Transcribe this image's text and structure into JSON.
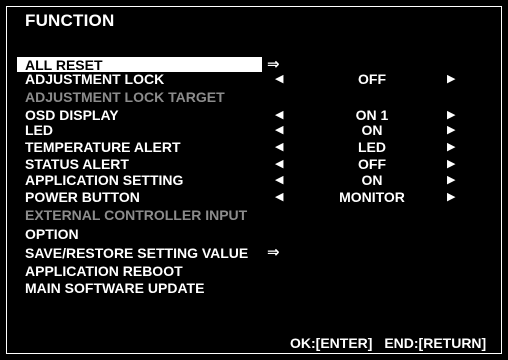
{
  "title": "FUNCTION",
  "icons": {
    "left": "◀",
    "right": "▶",
    "enter": "⇒"
  },
  "rows": [
    {
      "label": "ALL RESET",
      "value": ""
    },
    {
      "label": "ADJUSTMENT LOCK",
      "value": "OFF"
    },
    {
      "label": "ADJUSTMENT LOCK TARGET",
      "value": ""
    },
    {
      "label": "OSD DISPLAY",
      "value": "ON 1"
    },
    {
      "label": "LED",
      "value": "ON"
    },
    {
      "label": "TEMPERATURE ALERT",
      "value": "LED"
    },
    {
      "label": "STATUS ALERT",
      "value": "OFF"
    },
    {
      "label": "APPLICATION SETTING",
      "value": "ON"
    },
    {
      "label": "POWER BUTTON",
      "value": "MONITOR"
    },
    {
      "label": "EXTERNAL CONTROLLER INPUT",
      "value": ""
    },
    {
      "label": "OPTION",
      "value": ""
    },
    {
      "label": "SAVE/RESTORE SETTING VALUE",
      "value": ""
    },
    {
      "label": "APPLICATION REBOOT",
      "value": ""
    },
    {
      "label": "MAIN SOFTWARE UPDATE",
      "value": ""
    }
  ],
  "footer": {
    "ok": "OK:[ENTER]",
    "end": "END:[RETURN]"
  },
  "colors": {
    "background": "#000000",
    "text": "#ffffff",
    "disabled": "#8c8c8c",
    "highlight": "#ffffff"
  }
}
